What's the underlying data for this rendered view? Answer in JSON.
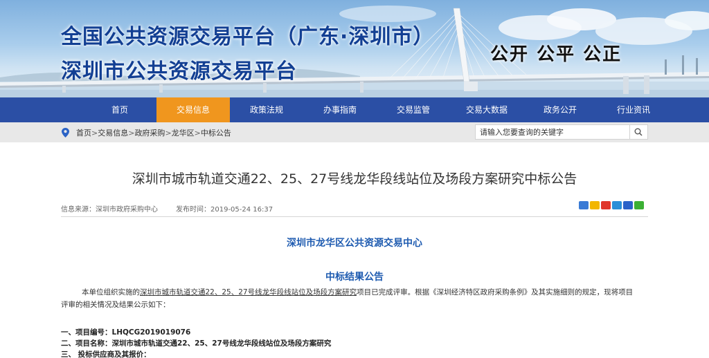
{
  "header": {
    "title": "全国公共资源交易平台（广东·深圳市）",
    "subtitle": "深圳市公共资源交易平台",
    "slogan": "公开  公平  公正"
  },
  "nav": {
    "items": [
      "首页",
      "交易信息",
      "政策法规",
      "办事指南",
      "交易监管",
      "交易大数据",
      "政务公开",
      "行业资讯"
    ],
    "active_index": 1
  },
  "breadcrumb": {
    "items": [
      "首页",
      "交易信息",
      "政府采购",
      "龙华区",
      "中标公告"
    ],
    "separator": ">"
  },
  "search": {
    "placeholder": "请输入您要查询的关键字"
  },
  "article": {
    "title": "深圳市城市轨道交通22、25、27号线龙华段线站位及场段方案研究中标公告",
    "source_label": "信息来源：深圳市政府采购中心",
    "publish_label": "发布时间：2019-05-24 16:37",
    "organization": "深圳市龙华区公共资源交易中心",
    "heading": "中标结果公告",
    "intro_prefix": "本单位组织实施的",
    "intro_link": "深圳市城市轨道交通22、25、27号线龙华段线站位及场段方案研究",
    "intro_suffix": "项目已完成评审。根据《深圳经济特区政府采购条例》及其实施细则的规定，现将项目评审的相关情况及结果公示如下：",
    "items": [
      "一、项目编号：LHQCG2019019076",
      "二、项目名称：深圳市城市轨道交通22、25、27号线龙华段线站位及场段方案研究",
      "三、 投标供应商及其报价："
    ]
  },
  "share": {
    "icons": [
      "share-plus-icon",
      "qzone-icon",
      "weibo-icon",
      "tencent-weibo-icon",
      "renren-icon",
      "wechat-icon"
    ],
    "colors": [
      "#3a7bd5",
      "#f2b600",
      "#e0362c",
      "#2b8fd8",
      "#2a62c9",
      "#3cb034"
    ]
  },
  "colors": {
    "nav_bg": "#2b4fa5",
    "nav_active": "#f0961e",
    "title_blue": "#123f93",
    "heading_blue": "#1e5bb0"
  }
}
